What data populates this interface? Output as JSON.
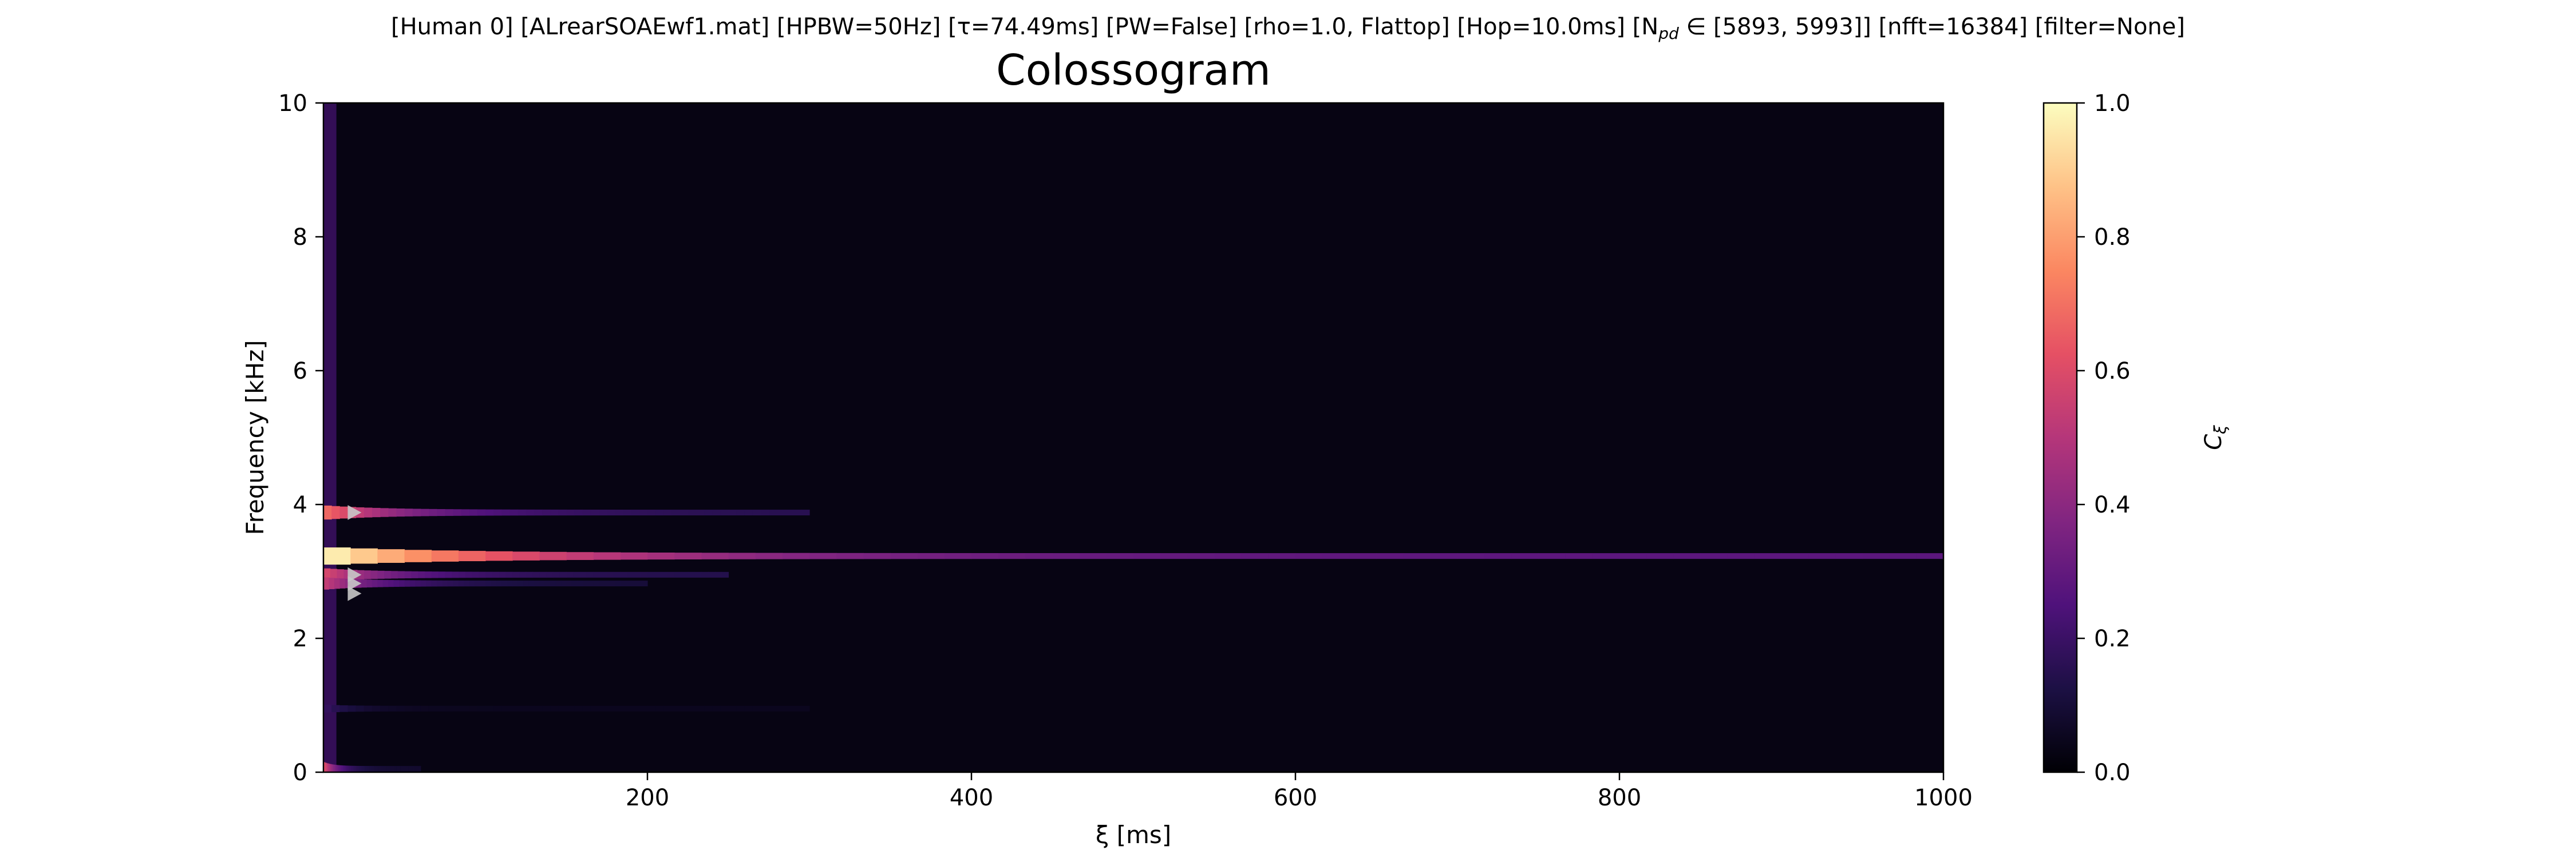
{
  "header": {
    "text": "[Human 0]   [ALrearSOAEwf1.mat]   [HPBW=50Hz]   [τ=74.49ms]   [PW=False]   [rho=1.0, Flattop]   [Hop=10.0ms]   [N",
    "npd_sub": "pd",
    "npd_rest": " ∈ [5893, 5993]]   [nfft=16384]   [filter=None]"
  },
  "chart_data": {
    "type": "heatmap",
    "title": "Colossogram",
    "xlabel": "ξ [ms]",
    "ylabel": "Frequency [kHz]",
    "xlim": [
      0,
      1000
    ],
    "ylim": [
      0,
      10
    ],
    "x_ticks": [
      "200",
      "400",
      "600",
      "800",
      "1000"
    ],
    "x_tick_values": [
      200,
      400,
      600,
      800,
      1000
    ],
    "y_ticks": [
      "0",
      "2",
      "4",
      "6",
      "8",
      "10"
    ],
    "y_tick_values": [
      0,
      2,
      4,
      6,
      8,
      10
    ],
    "colormap": "magma",
    "colorbar": {
      "label": "C_ξ",
      "range": [
        0,
        1
      ],
      "ticks": [
        "0.0",
        "0.2",
        "0.4",
        "0.6",
        "0.8",
        "1.0"
      ],
      "tick_values": [
        0,
        0.2,
        0.4,
        0.6,
        0.8,
        1.0
      ]
    },
    "background_coherence": 0.03,
    "bands": [
      {
        "freq_khz": 3.23,
        "peak": 1.0,
        "tail": 0.28,
        "decay_ms": 150,
        "reach_ms": 1000
      },
      {
        "freq_khz": 3.88,
        "peak": 0.7,
        "tail": 0.15,
        "decay_ms": 60,
        "reach_ms": 300
      },
      {
        "freq_khz": 2.95,
        "peak": 0.6,
        "tail": 0.14,
        "decay_ms": 50,
        "reach_ms": 250
      },
      {
        "freq_khz": 2.82,
        "peak": 0.55,
        "tail": 0.1,
        "decay_ms": 40,
        "reach_ms": 200
      },
      {
        "freq_khz": 0.05,
        "peak": 0.65,
        "tail": 0.08,
        "decay_ms": 10,
        "reach_ms": 60
      },
      {
        "freq_khz": 0.95,
        "peak": 0.2,
        "tail": 0.05,
        "decay_ms": 20,
        "reach_ms": 300
      }
    ],
    "peak_markers_khz": [
      3.88,
      2.95,
      2.82,
      2.67
    ],
    "marker_color": "#c8c8c8"
  }
}
